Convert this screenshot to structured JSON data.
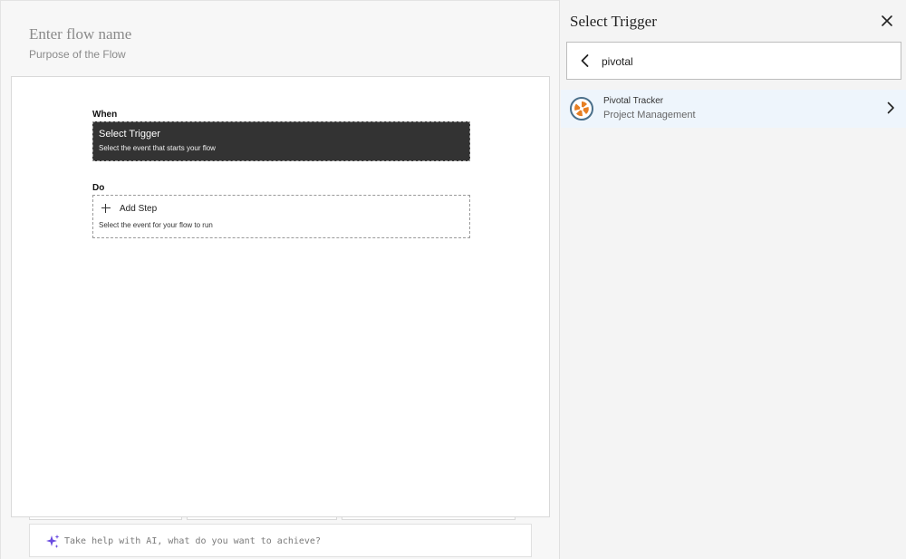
{
  "flow": {
    "name_placeholder": "Enter flow name",
    "purpose_placeholder": "Purpose of the Flow"
  },
  "canvas": {
    "when_label": "When",
    "trigger": {
      "title": "Select Trigger",
      "subtitle": "Select the event that starts your flow"
    },
    "do_label": "Do",
    "step": {
      "title": "Add Step",
      "subtitle": "Select the event for your flow to run"
    }
  },
  "ai_bar": {
    "placeholder": "Take help with AI, what do you want to achieve?"
  },
  "panel": {
    "title": "Select Trigger",
    "search": {
      "value": "pivotal"
    },
    "results": [
      {
        "name": "Pivotal Tracker",
        "category": "Project Management"
      }
    ]
  },
  "icons": {
    "close": "close-icon",
    "back": "chevron-left-icon",
    "result_chevron": "chevron-right-icon",
    "sparkle": "sparkle-icon",
    "plus": "plus-icon",
    "app_logo": "pivotal-tracker-logo"
  },
  "colors": {
    "trigger_bg": "#333333",
    "result_bg": "#eef5fc",
    "ai_accent": "#6a4be0",
    "pivotal_orange": "#e67e22",
    "pivotal_blue": "#4a6f8a"
  }
}
